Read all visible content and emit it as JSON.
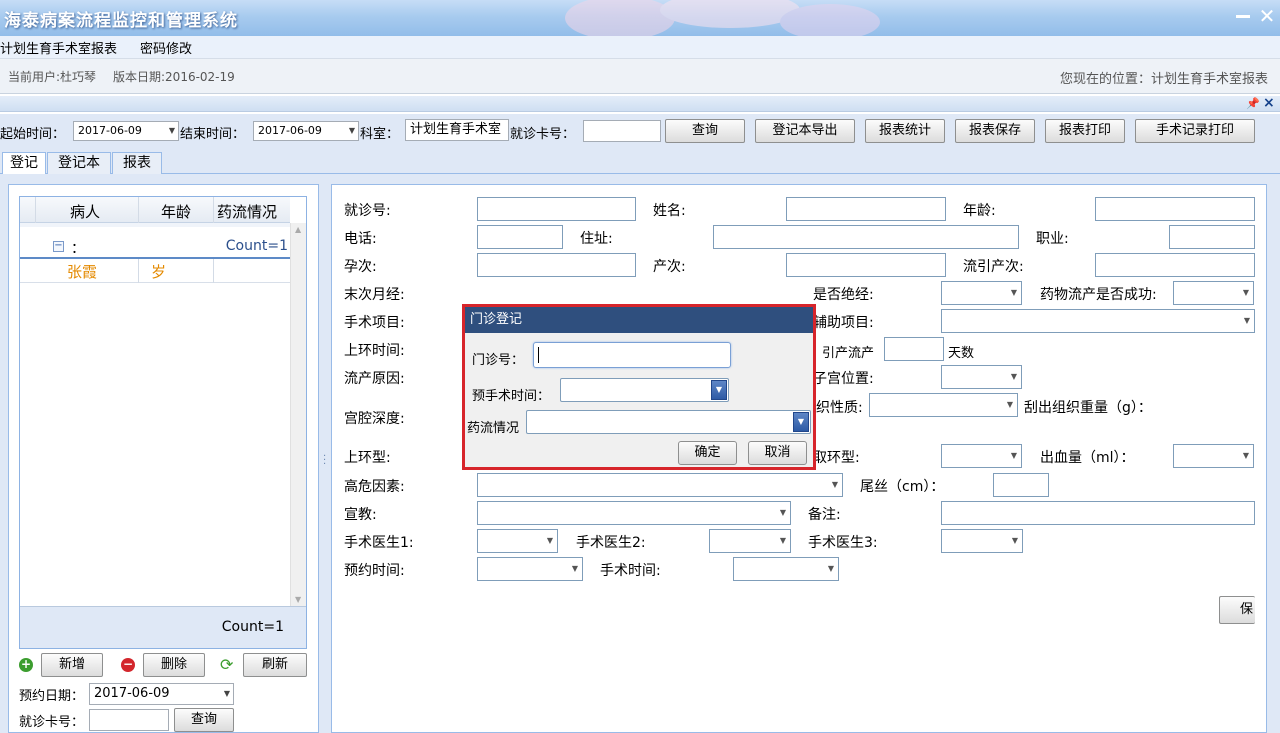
{
  "app": {
    "title": "海泰病案流程监控和管理系统"
  },
  "menu": {
    "items": [
      "计划生育手术室报表",
      "密码修改"
    ]
  },
  "info": {
    "current_user": "当前用户:杜巧琴",
    "version_date": "版本日期:2016-02-19",
    "location": "您现在的位置：计划生育手术室报表"
  },
  "toolbar": {
    "start_label": "起始时间：",
    "start_value": "2017-06-09",
    "end_label": "结束时间：",
    "end_value": "2017-06-09",
    "dept_label": "科室：",
    "dept_value": "计划生育手术室",
    "card_label": "就诊卡号：",
    "buttons": [
      "查询",
      "登记本导出",
      "报表统计",
      "报表保存",
      "报表打印",
      "手术记录打印"
    ]
  },
  "tabs": [
    "登记",
    "登记本",
    "报表"
  ],
  "grid": {
    "columns": [
      "病人",
      "年龄",
      "药流情况"
    ],
    "group_label": "：",
    "group_count": "Count=1",
    "rows": [
      {
        "patient": "张霞",
        "age": "岁",
        "med": ""
      }
    ],
    "footer_count": "Count=1"
  },
  "left_actions": {
    "add": "新增",
    "delete": "删除",
    "refresh": "刷新"
  },
  "booking": {
    "date_label": "预约日期：",
    "date_value": "2017-06-09",
    "card_label": "就诊卡号：",
    "query": "查询"
  },
  "form": {
    "visit_no": "就诊号:",
    "name": "姓名:",
    "age": "年龄:",
    "phone": "电话:",
    "address": "住址:",
    "occupation": "职业:",
    "gravidity": "孕次:",
    "parity": "产次:",
    "induced_count": "流引产次:",
    "lmp": "末次月经:",
    "menopause": "是否绝经:",
    "med_abortion_success": "药物流产是否成功:",
    "surgery_item": "手术项目:",
    "aux_item": "辅助项目:",
    "iud_time": "上环时间:",
    "induced_abortion": "引产流产",
    "days": "天数",
    "abortion_reason": "流产原因:",
    "uterus_position": "子宫位置:",
    "uterine_depth": "宫腔深度:",
    "tissue_nature": "织性质:",
    "tissue_weight": "刮出组织重量（g）：",
    "iud_type": "上环型:",
    "iud_removal_type": "取环型:",
    "blood_loss": "出血量（ml）：",
    "high_risk": "高危因素:",
    "tail_wire": "尾丝（cm）：",
    "education": "宣教:",
    "remarks": "备注:",
    "doctor1": "手术医生1:",
    "doctor2": "手术医生2:",
    "doctor3": "手术医生3:",
    "appointment_time": "预约时间:",
    "surgery_time": "手术时间:",
    "save_partial": "保"
  },
  "dialog": {
    "title": "门诊登记",
    "clinic_no": "门诊号：",
    "pre_op_time": "预手术时间：",
    "med_status": "药流情况",
    "ok": "确定",
    "cancel": "取消"
  },
  "colors": {
    "title_bar": "#a8cbef",
    "toolbar_bg": "#dfe8f6",
    "dialog_title": "#2f4f7e",
    "highlight_border": "#d7252b",
    "row_text": "#e48a00"
  }
}
